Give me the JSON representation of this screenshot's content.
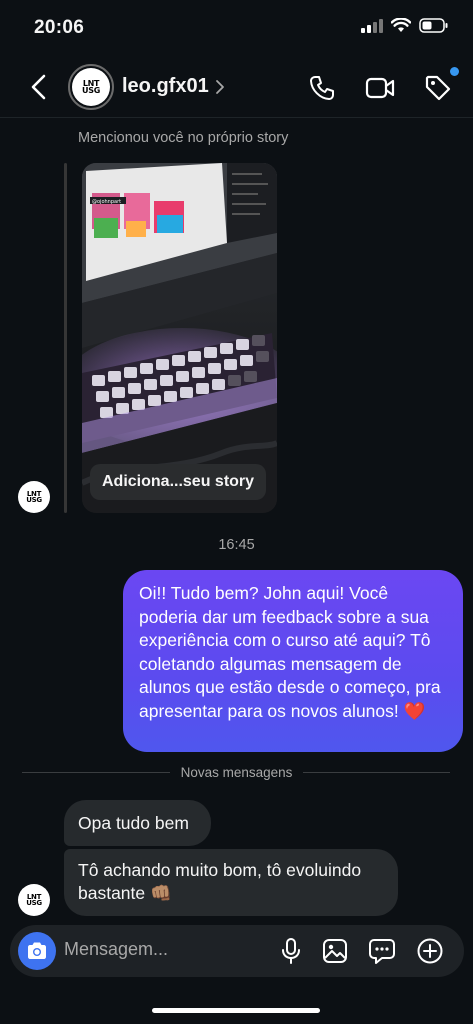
{
  "status_bar": {
    "time": "20:06"
  },
  "header": {
    "username": "leo.gfx01",
    "avatar_text_line1": "LNT",
    "avatar_text_line2": "USG"
  },
  "story": {
    "mention_label": "Mencionou você no próprio story",
    "caption": "Adiciona...seu story",
    "overlay_tag": "@ojohnpart"
  },
  "timestamp": "16:45",
  "sent_message": {
    "text": "Oi!! Tudo bem? John aqui! Você poderia dar um feedback sobre a sua experiência com o curso até aqui? Tô coletando algumas mensagem de alunos que estão desde o começo, pra apresentar para os novos alunos! ❤️"
  },
  "new_messages_divider": "Novas mensagens",
  "received_messages": [
    {
      "text": "Opa tudo bem"
    },
    {
      "text": "Tô achando muito bom, tô evoluindo bastante 👊🏽"
    }
  ],
  "composer": {
    "placeholder": "Mensagem..."
  },
  "colors": {
    "background": "#0c1014",
    "sent_bubble_top": "#6b47f2",
    "sent_bubble_bottom": "#4f57ee",
    "received_bubble": "#262a2d",
    "camera_button": "#3e73f0",
    "notification_dot": "#3797f0"
  },
  "icons": [
    "back-chevron-icon",
    "chevron-right-icon",
    "phone-icon",
    "video-icon",
    "tag-icon",
    "camera-icon",
    "microphone-icon",
    "image-icon",
    "sticker-icon",
    "plus-circle-icon",
    "signal-icon",
    "wifi-icon",
    "battery-icon"
  ]
}
